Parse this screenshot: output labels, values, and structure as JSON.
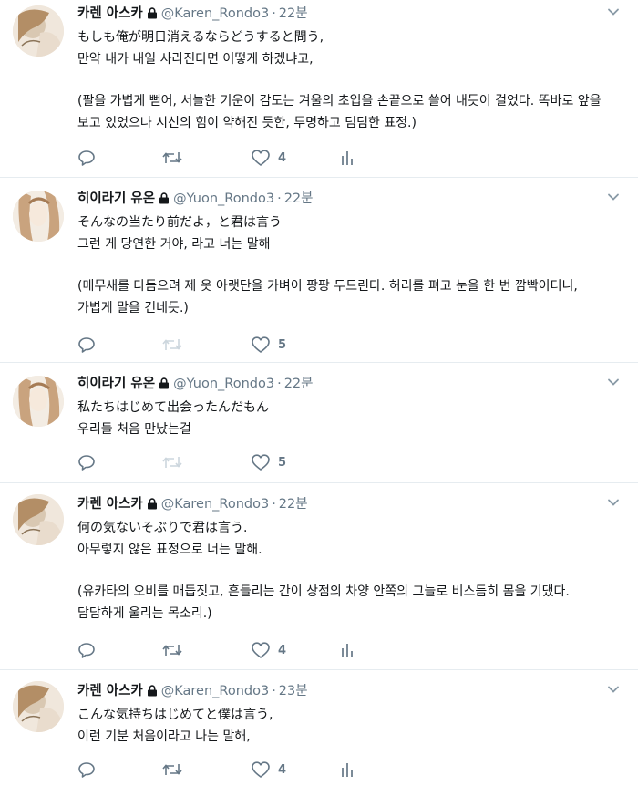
{
  "tweets": [
    {
      "name": "카렌 아스카",
      "handle": "@Karen_Rondo3",
      "time": "22분",
      "lines": [
        "もしも俺が明日消えるならどうすると問う,",
        "만약 내가 내일 사라진다면 어떻게 하겠냐고,"
      ],
      "paragraph": "(팔을 가볍게 뻗어, 서늘한 기운이 감도는 겨울의 초입을 손끝으로 쓸어 내듯이 걸었다. 똑바로 앞을 보고 있었으나 시선의 힘이 약해진 듯한, 투명하고 덤덤한 표정.)",
      "likes": "4"
    },
    {
      "name": "히이라기 유온",
      "handle": "@Yuon_Rondo3",
      "time": "22분",
      "lines": [
        "そんなの当たり前だよ，と君は言う",
        "그런 게 당연한 거야, 라고 너는 말해"
      ],
      "paragraph": "(매무새를 다듬으려 제 옷 아랫단을 가벼이 팡팡 두드린다. 허리를 펴고 눈을 한 번 깜빡이더니, 가볍게 말을 건네듯.)",
      "likes": "5"
    },
    {
      "name": "히이라기 유온",
      "handle": "@Yuon_Rondo3",
      "time": "22분",
      "lines": [
        "私たちはじめて出会ったんだもん",
        "우리들 처음 만났는걸"
      ],
      "paragraph": "",
      "likes": "5"
    },
    {
      "name": "카렌 아스카",
      "handle": "@Karen_Rondo3",
      "time": "22분",
      "lines": [
        "何の気ないそぶりで君は言う.",
        "아무렇지 않은 표정으로 너는 말해."
      ],
      "paragraph": "(유카타의 오비를 매듭짓고, 흔들리는 간이 상점의 차양 안쪽의 그늘로 비스듬히 몸을 기댔다. 담담하게 울리는 목소리.)",
      "likes": "4"
    },
    {
      "name": "카렌 아스카",
      "handle": "@Karen_Rondo3",
      "time": "23분",
      "lines": [
        "こんな気持ちはじめてと僕は言う,",
        "이런 기분 처음이라고 나는 말해,"
      ],
      "paragraph": "",
      "likes": "4"
    }
  ],
  "ui": {
    "dot": "·",
    "icons": {
      "reply": "reply-icon",
      "retweet": "retweet-icon",
      "like": "heart-icon",
      "stats": "bar-chart-icon",
      "lock": "lock-icon",
      "caret": "chevron-down-icon"
    },
    "colors": {
      "text": "#14171a",
      "muted": "#657786",
      "divider": "#e6ecf0",
      "disabled_icon": "#ccd6dd"
    }
  }
}
